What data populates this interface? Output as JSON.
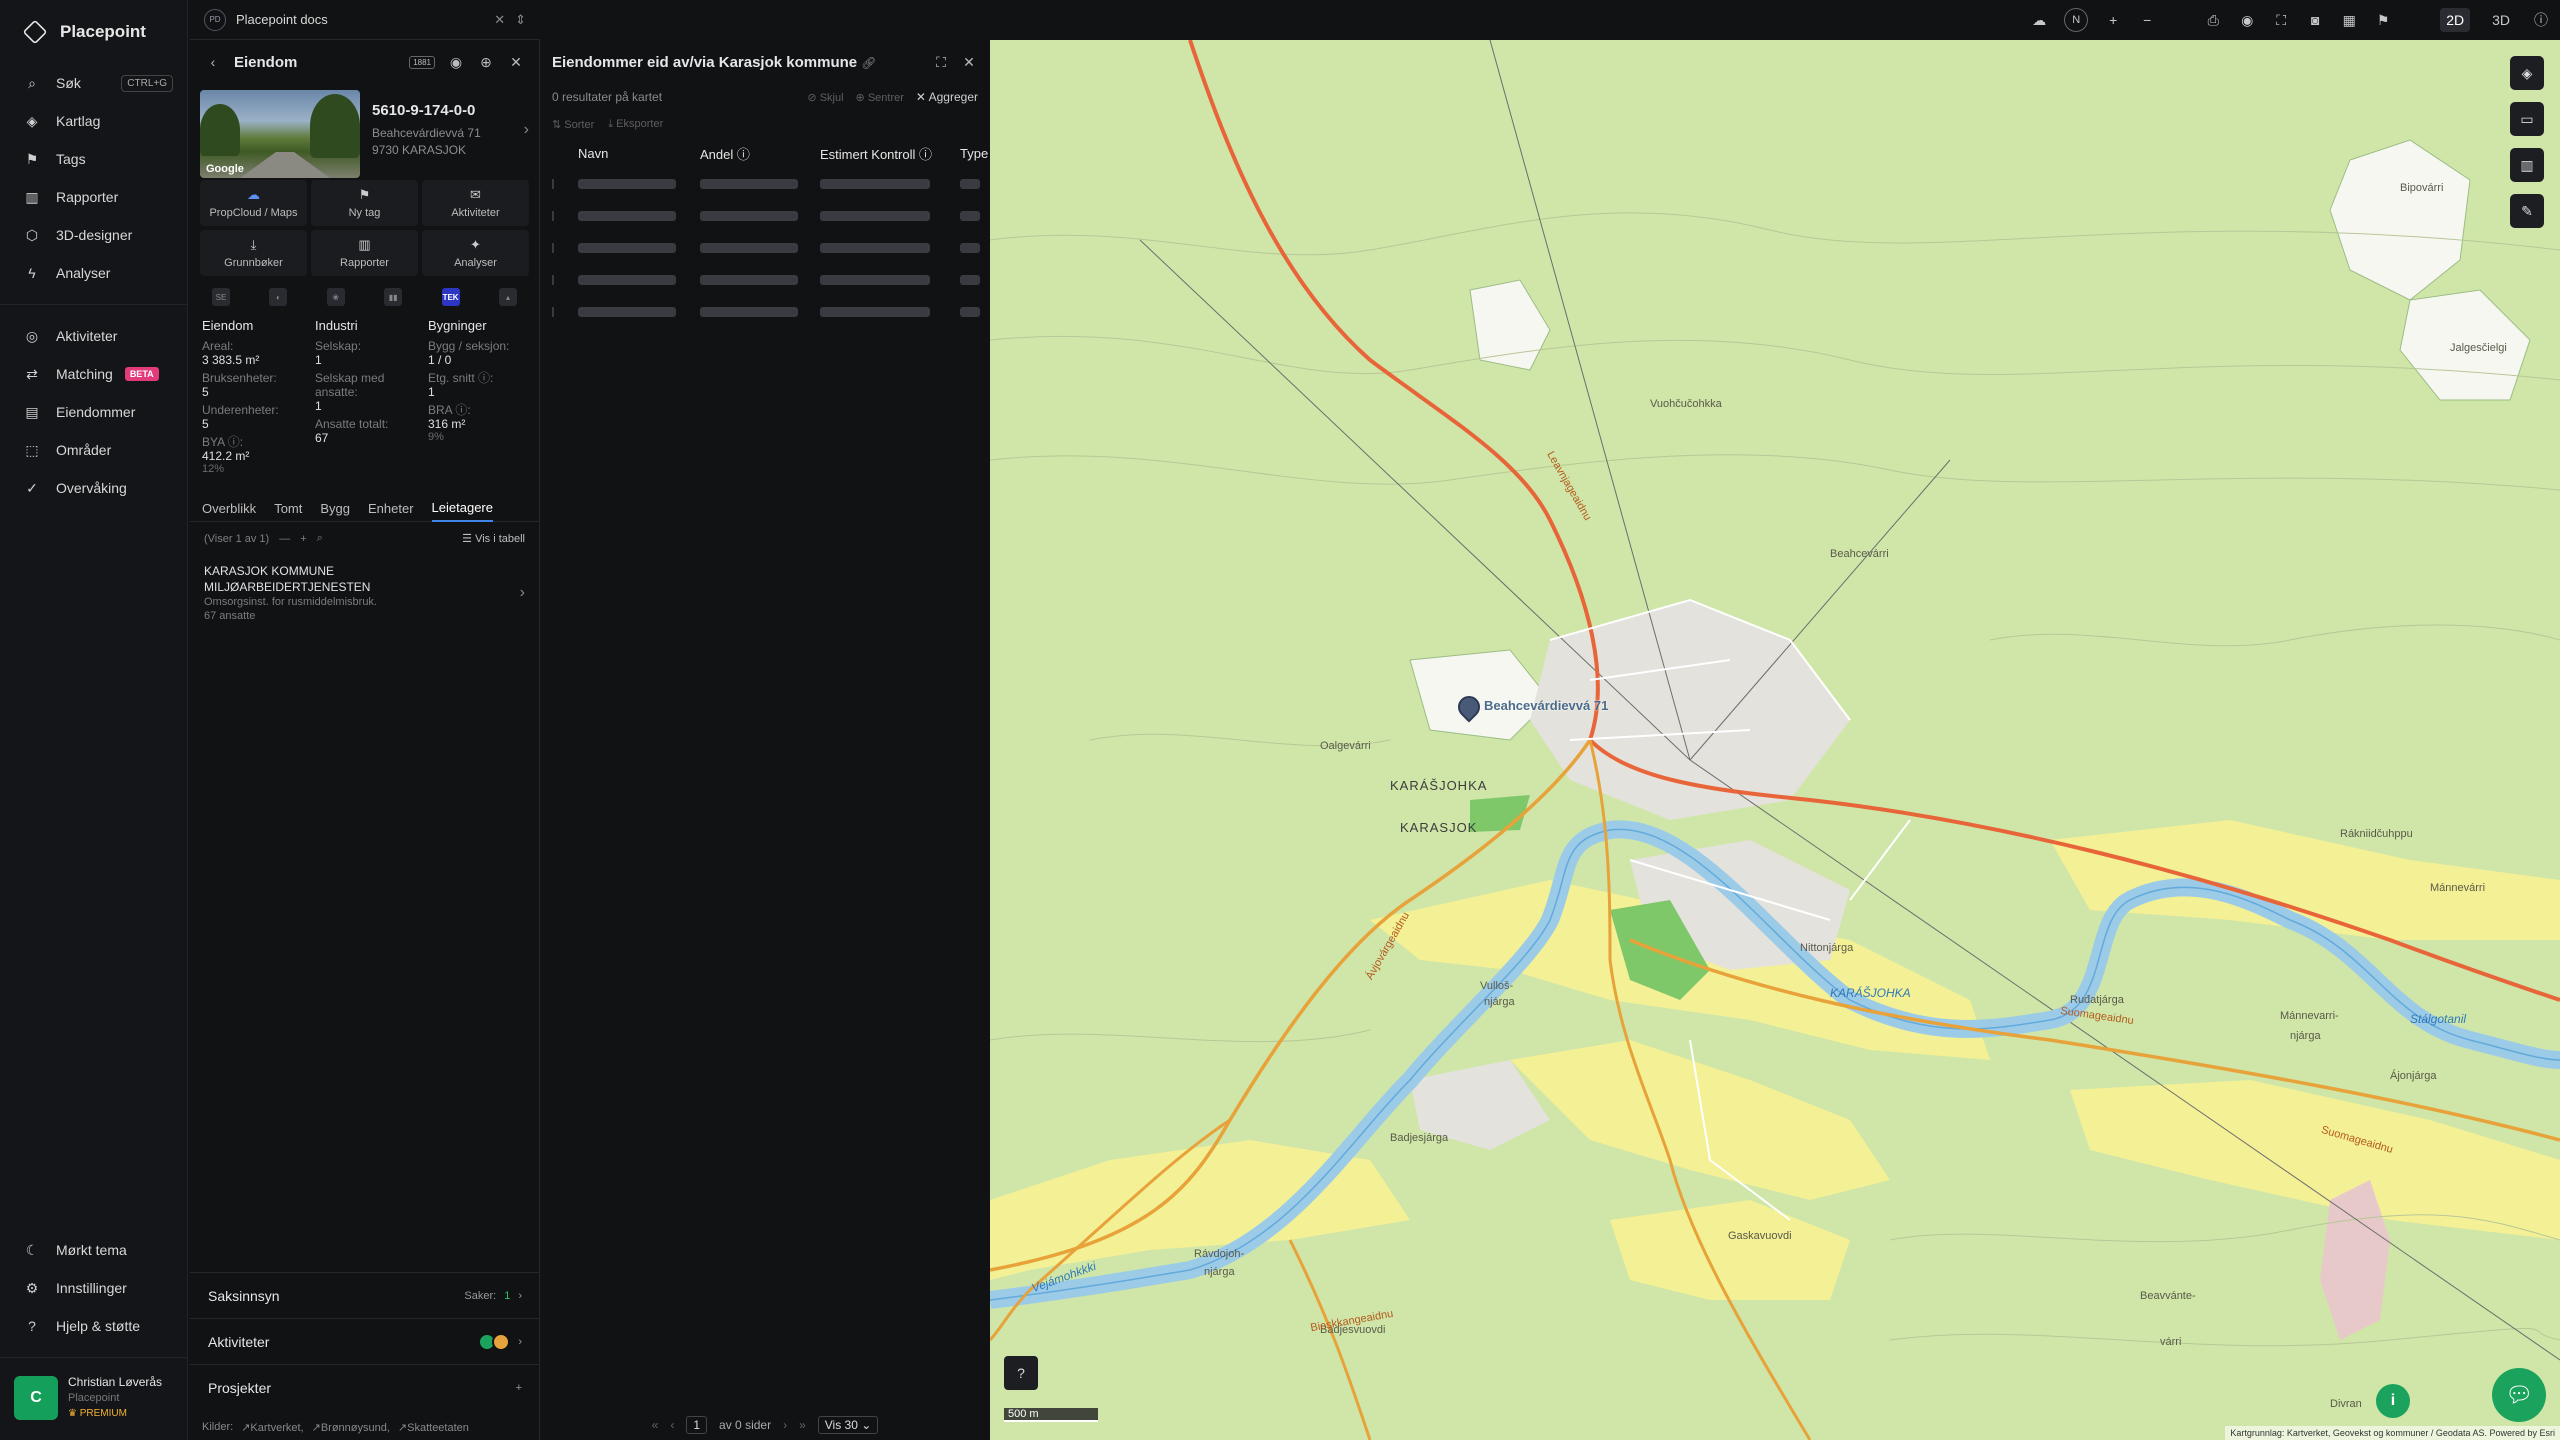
{
  "app": {
    "brand": "Placepoint"
  },
  "nav": {
    "primary": [
      {
        "label": "Søk",
        "icon": "search-icon",
        "kbd": "CTRL+G"
      },
      {
        "label": "Kartlag",
        "icon": "layers-icon"
      },
      {
        "label": "Tags",
        "icon": "bookmark-icon"
      },
      {
        "label": "Rapporter",
        "icon": "bar-chart-icon"
      },
      {
        "label": "3D-designer",
        "icon": "cube-icon"
      },
      {
        "label": "Analyser",
        "icon": "bolt-icon"
      }
    ],
    "secondary": [
      {
        "label": "Aktiviteter",
        "icon": "activity-icon"
      },
      {
        "label": "Matching",
        "icon": "match-icon",
        "badge": "BETA"
      },
      {
        "label": "Eiendommer",
        "icon": "building-icon"
      },
      {
        "label": "Områder",
        "icon": "area-icon"
      },
      {
        "label": "Overvåking",
        "icon": "check-circle-icon"
      }
    ],
    "bottom": [
      {
        "label": "Mørkt tema",
        "icon": "moon-icon"
      },
      {
        "label": "Innstillinger",
        "icon": "gear-icon"
      },
      {
        "label": "Hjelp & støtte",
        "icon": "help-icon"
      }
    ],
    "user": {
      "initial": "C",
      "name": "Christian Løverås",
      "org": "Placepoint",
      "plan": "PREMIUM"
    }
  },
  "docs": {
    "badge": "PD",
    "title": "Placepoint docs"
  },
  "property": {
    "header": "Eiendom",
    "header_badge": "1881",
    "thumb_label": "Google",
    "id": "5610-9-174-0-0",
    "address1": "Beahcevárdievvá 71",
    "address2": "9730 KARASJOK",
    "actions": [
      {
        "label": "PropCloud / Maps",
        "icon": "cloud-icon"
      },
      {
        "label": "Ny tag",
        "icon": "bookmark-icon"
      },
      {
        "label": "Aktiviteter",
        "icon": "message-icon"
      },
      {
        "label": "Grunnbøker",
        "icon": "download-icon"
      },
      {
        "label": "Rapporter",
        "icon": "bar-chart-icon"
      },
      {
        "label": "Analyser",
        "icon": "bulb-icon"
      }
    ],
    "sources": [
      {
        "label": "SE"
      },
      {
        "label": "◐"
      },
      {
        "label": "❀"
      },
      {
        "label": "▮▮"
      },
      {
        "label": "TEK"
      },
      {
        "label": "▴"
      }
    ],
    "facts": {
      "eiendom": {
        "title": "Eiendom",
        "areal_label": "Areal:",
        "areal_value": "3 383.5 m²",
        "bruks_label": "Bruksenheter:",
        "bruks_value": "5",
        "under_label": "Underenheter:",
        "under_value": "5",
        "bya_label": "BYA ⓘ:",
        "bya_value": "412.2 m²",
        "bya_pct": "12%"
      },
      "industri": {
        "title": "Industri",
        "selskap_label": "Selskap:",
        "selskap_value": "1",
        "med_label": "Selskap med ansatte:",
        "med_value": "1",
        "ans_label": "Ansatte totalt:",
        "ans_value": "67"
      },
      "bygninger": {
        "title": "Bygninger",
        "bygg_label": "Bygg / seksjon:",
        "bygg_value": "1 / 0",
        "etg_label": "Etg. snitt ⓘ:",
        "etg_value": "1",
        "bra_label": "BRA ⓘ:",
        "bra_value": "316 m²",
        "bra_pct": "9%"
      }
    },
    "tabs": [
      "Overblikk",
      "Tomt",
      "Bygg",
      "Enheter",
      "Leietagere"
    ],
    "active_tab": "Leietagere",
    "list_count": "(Viser 1 av 1)",
    "table_view": "Vis i tabell",
    "tenant": {
      "line1": "KARASJOK KOMMUNE",
      "line2": "MILJØARBEIDERTJENESTEN",
      "line3": "Omsorgsinst. for rusmiddelmisbruk.",
      "line4": "67 ansatte"
    },
    "saksinnsyn": {
      "label": "Saksinnsyn",
      "saker_label": "Saker:",
      "saker_value": "1"
    },
    "aktiviteter_label": "Aktiviteter",
    "prosjekter_label": "Prosjekter",
    "kilder": {
      "label": "Kilder:",
      "items": [
        "Kartverket,",
        "Brønnøysund,",
        "Skatteetaten"
      ]
    }
  },
  "results": {
    "title": "Eiendommer eid av/via Karasjok kommune",
    "count": "0 resultater på kartet",
    "skjul": "Skjul",
    "sentrer": "Sentrer",
    "aggreger": "Aggreger",
    "sorter": "Sorter",
    "eksporter": "Eksporter",
    "columns": [
      "Navn",
      "Andel ⓘ",
      "Estimert Kontroll ⓘ",
      "Type"
    ],
    "pager": {
      "page": "1",
      "of": "av 0 sider",
      "per_page": "Vis 30"
    }
  },
  "topbar": {
    "compass": "N",
    "mode_2d": "2D",
    "mode_3d": "3D"
  },
  "map": {
    "labels": [
      {
        "text": "KARÁŠJOHKA",
        "cls": "big"
      },
      {
        "text": "KARASJOK",
        "cls": "big"
      },
      {
        "text": "Oalgevárri",
        "cls": ""
      },
      {
        "text": "Vuohčučohkka",
        "cls": ""
      },
      {
        "text": "Beahcevárri",
        "cls": ""
      },
      {
        "text": "Bipovárri",
        "cls": ""
      },
      {
        "text": "Jalgesčielgi",
        "cls": ""
      },
      {
        "text": "Mánnevárri",
        "cls": ""
      },
      {
        "text": "Rákniidčuhppu",
        "cls": ""
      },
      {
        "text": "Nittonjárga",
        "cls": ""
      },
      {
        "text": "Vulloš-",
        "cls": ""
      },
      {
        "text": "njárga",
        "cls": ""
      },
      {
        "text": "Badjesjárga",
        "cls": ""
      },
      {
        "text": "Rávdojoh-",
        "cls": ""
      },
      {
        "text": "njárga",
        "cls": ""
      },
      {
        "text": "Gaskavuovdi",
        "cls": ""
      },
      {
        "text": "Beavvánte-",
        "cls": ""
      },
      {
        "text": "várri",
        "cls": ""
      },
      {
        "text": "Ruđatjárga",
        "cls": ""
      },
      {
        "text": "Mánnevarri-",
        "cls": ""
      },
      {
        "text": "njárga",
        "cls": ""
      },
      {
        "text": "Ájonjárga",
        "cls": ""
      },
      {
        "text": "Badjesvuovdi",
        "cls": ""
      },
      {
        "text": "Divran",
        "cls": ""
      },
      {
        "text": "KARÁŠJOHKA",
        "cls": "river"
      },
      {
        "text": "Suomageaidnu",
        "cls": "road"
      },
      {
        "text": "Suomageaidnu",
        "cls": "road"
      },
      {
        "text": "Ávjovárgeaidnu",
        "cls": "road"
      },
      {
        "text": "Leavnjageaidnu",
        "cls": "road"
      },
      {
        "text": "Bieskkangeaidnu",
        "cls": "road"
      },
      {
        "text": "Stálgotanil",
        "cls": "river"
      },
      {
        "text": "Vejámohkkki",
        "cls": "river"
      }
    ],
    "marker_label": "Beahcevárdievvá 71",
    "scale": "500 m",
    "attribution": "Kartgrunnlag: Kartverket, Geovekst og kommuner / Geodata AS. Powered by Esri"
  }
}
